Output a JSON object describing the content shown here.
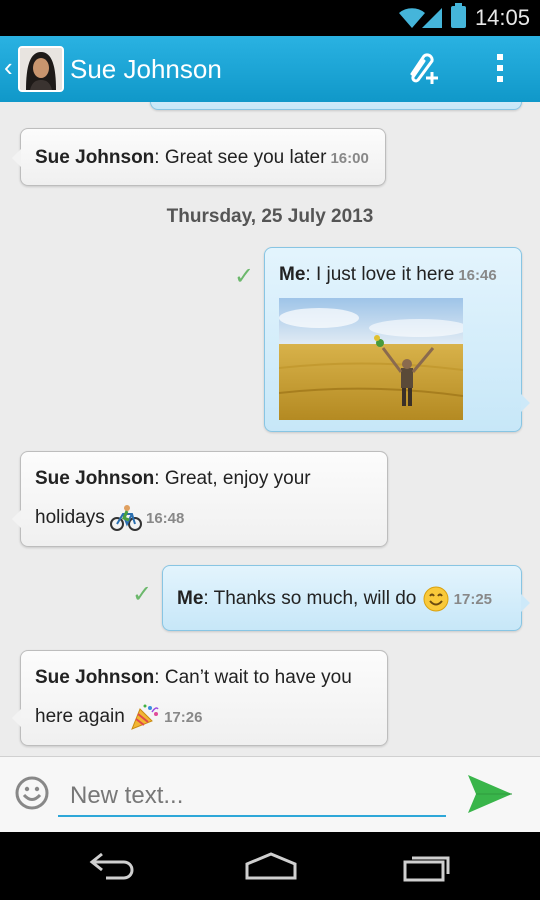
{
  "status": {
    "time": "14:05"
  },
  "header": {
    "contact_name": "Sue Johnson"
  },
  "messages": [
    {
      "sender": "Sue Johnson",
      "text": ": Great see you later",
      "time": "16:00"
    },
    {
      "date": "Thursday, 25 July 2013"
    },
    {
      "sender": "Me",
      "text": ": I just love it here",
      "time": "16:46"
    },
    {
      "sender": "Sue Johnson",
      "text_line1": ": Great, enjoy your",
      "text_line2": "holidays",
      "time": "16:48"
    },
    {
      "sender": "Me",
      "text": ": Thanks so much, will do",
      "time": "17:25"
    },
    {
      "sender": "Sue Johnson",
      "text_line1": ": Can’t wait to have you",
      "text_line2": "here again",
      "time": "17:26"
    }
  ],
  "composer": {
    "placeholder": "New text..."
  },
  "colors": {
    "header": "#1ba6d6",
    "incoming": "#f5f5f5",
    "outgoing": "#d4edfa",
    "send": "#39b54a"
  },
  "icons": [
    "wifi-icon",
    "signal-icon",
    "battery-icon",
    "back-chevron-icon",
    "attach-add-icon",
    "overflow-menu-icon",
    "smiley-icon",
    "send-icon",
    "nav-back-icon",
    "nav-home-icon",
    "nav-recent-icon"
  ]
}
